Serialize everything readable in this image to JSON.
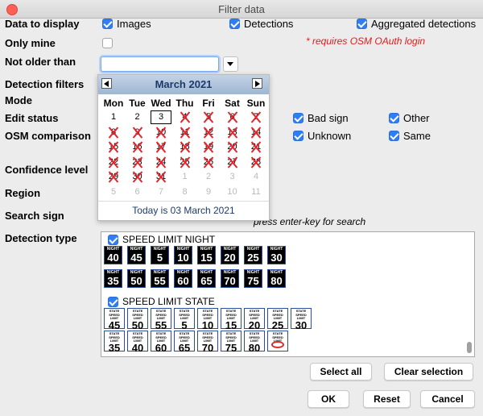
{
  "window": {
    "title": "Filter data"
  },
  "labels": {
    "data_to_display": "Data to display",
    "only_mine": "Only mine",
    "not_older_than": "Not older than",
    "detection_filters": "Detection filters",
    "mode": "Mode",
    "edit_status": "Edit status",
    "osm_comparison": "OSM comparison",
    "confidence_level": "Confidence level",
    "region": "Region",
    "search_sign": "Search sign",
    "detection_type": "Detection type"
  },
  "data_to_display": [
    {
      "label": "Images",
      "checked": true
    },
    {
      "label": "Detections",
      "checked": true
    },
    {
      "label": "Aggregated detections",
      "checked": true
    }
  ],
  "only_mine": {
    "checked": false,
    "note": "* requires OSM OAuth login"
  },
  "not_older_than": {
    "value": ""
  },
  "edit_status": [
    {
      "label": "Bad sign",
      "checked": true
    },
    {
      "label": "Other",
      "checked": true
    }
  ],
  "osm_comparison": [
    {
      "label": "Unknown",
      "checked": true
    },
    {
      "label": "Same",
      "checked": true
    }
  ],
  "search_sign": {
    "hint": "press enter-key for search"
  },
  "calendar": {
    "month_label": "March 2021",
    "weekdays": [
      "Mon",
      "Tue",
      "Wed",
      "Thu",
      "Fri",
      "Sat",
      "Sun"
    ],
    "rows": [
      [
        "1",
        "2",
        "3",
        "4",
        "5",
        "6",
        "7"
      ],
      [
        "8",
        "9",
        "10",
        "11",
        "12",
        "13",
        "14"
      ],
      [
        "15",
        "16",
        "17",
        "18",
        "19",
        "20",
        "21"
      ],
      [
        "22",
        "23",
        "24",
        "25",
        "26",
        "27",
        "28"
      ],
      [
        "29",
        "30",
        "31",
        "1",
        "2",
        "3",
        "4"
      ],
      [
        "5",
        "6",
        "7",
        "8",
        "9",
        "10",
        "11"
      ]
    ],
    "footer": "Today is  03 March 2021",
    "selected_day": "3"
  },
  "detection_groups": [
    {
      "label": "SPEED LIMIT NIGHT",
      "checked": true,
      "sign_caption": "NIGHT",
      "signs": [
        "40",
        "45",
        "5",
        "10",
        "15",
        "20",
        "25",
        "30",
        "35",
        "50",
        "55",
        "60",
        "65",
        "70",
        "75",
        "80"
      ]
    },
    {
      "label": "SPEED LIMIT STATE",
      "checked": true,
      "sign_caption": "STATE SPEED LIMIT",
      "signs": [
        "45",
        "50",
        "55",
        "5",
        "10",
        "15",
        "20",
        "25",
        "30",
        "35",
        "40",
        "60",
        "65",
        "70",
        "75",
        "80",
        ""
      ]
    }
  ],
  "buttons": {
    "select_all": "Select all",
    "clear_selection": "Clear selection",
    "ok": "OK",
    "reset": "Reset",
    "cancel": "Cancel"
  },
  "colors": {
    "accent": "#2f7ef5",
    "note": "#e01b1b",
    "calendar_header": "#9fb6d1",
    "cross": "#e4242b"
  }
}
